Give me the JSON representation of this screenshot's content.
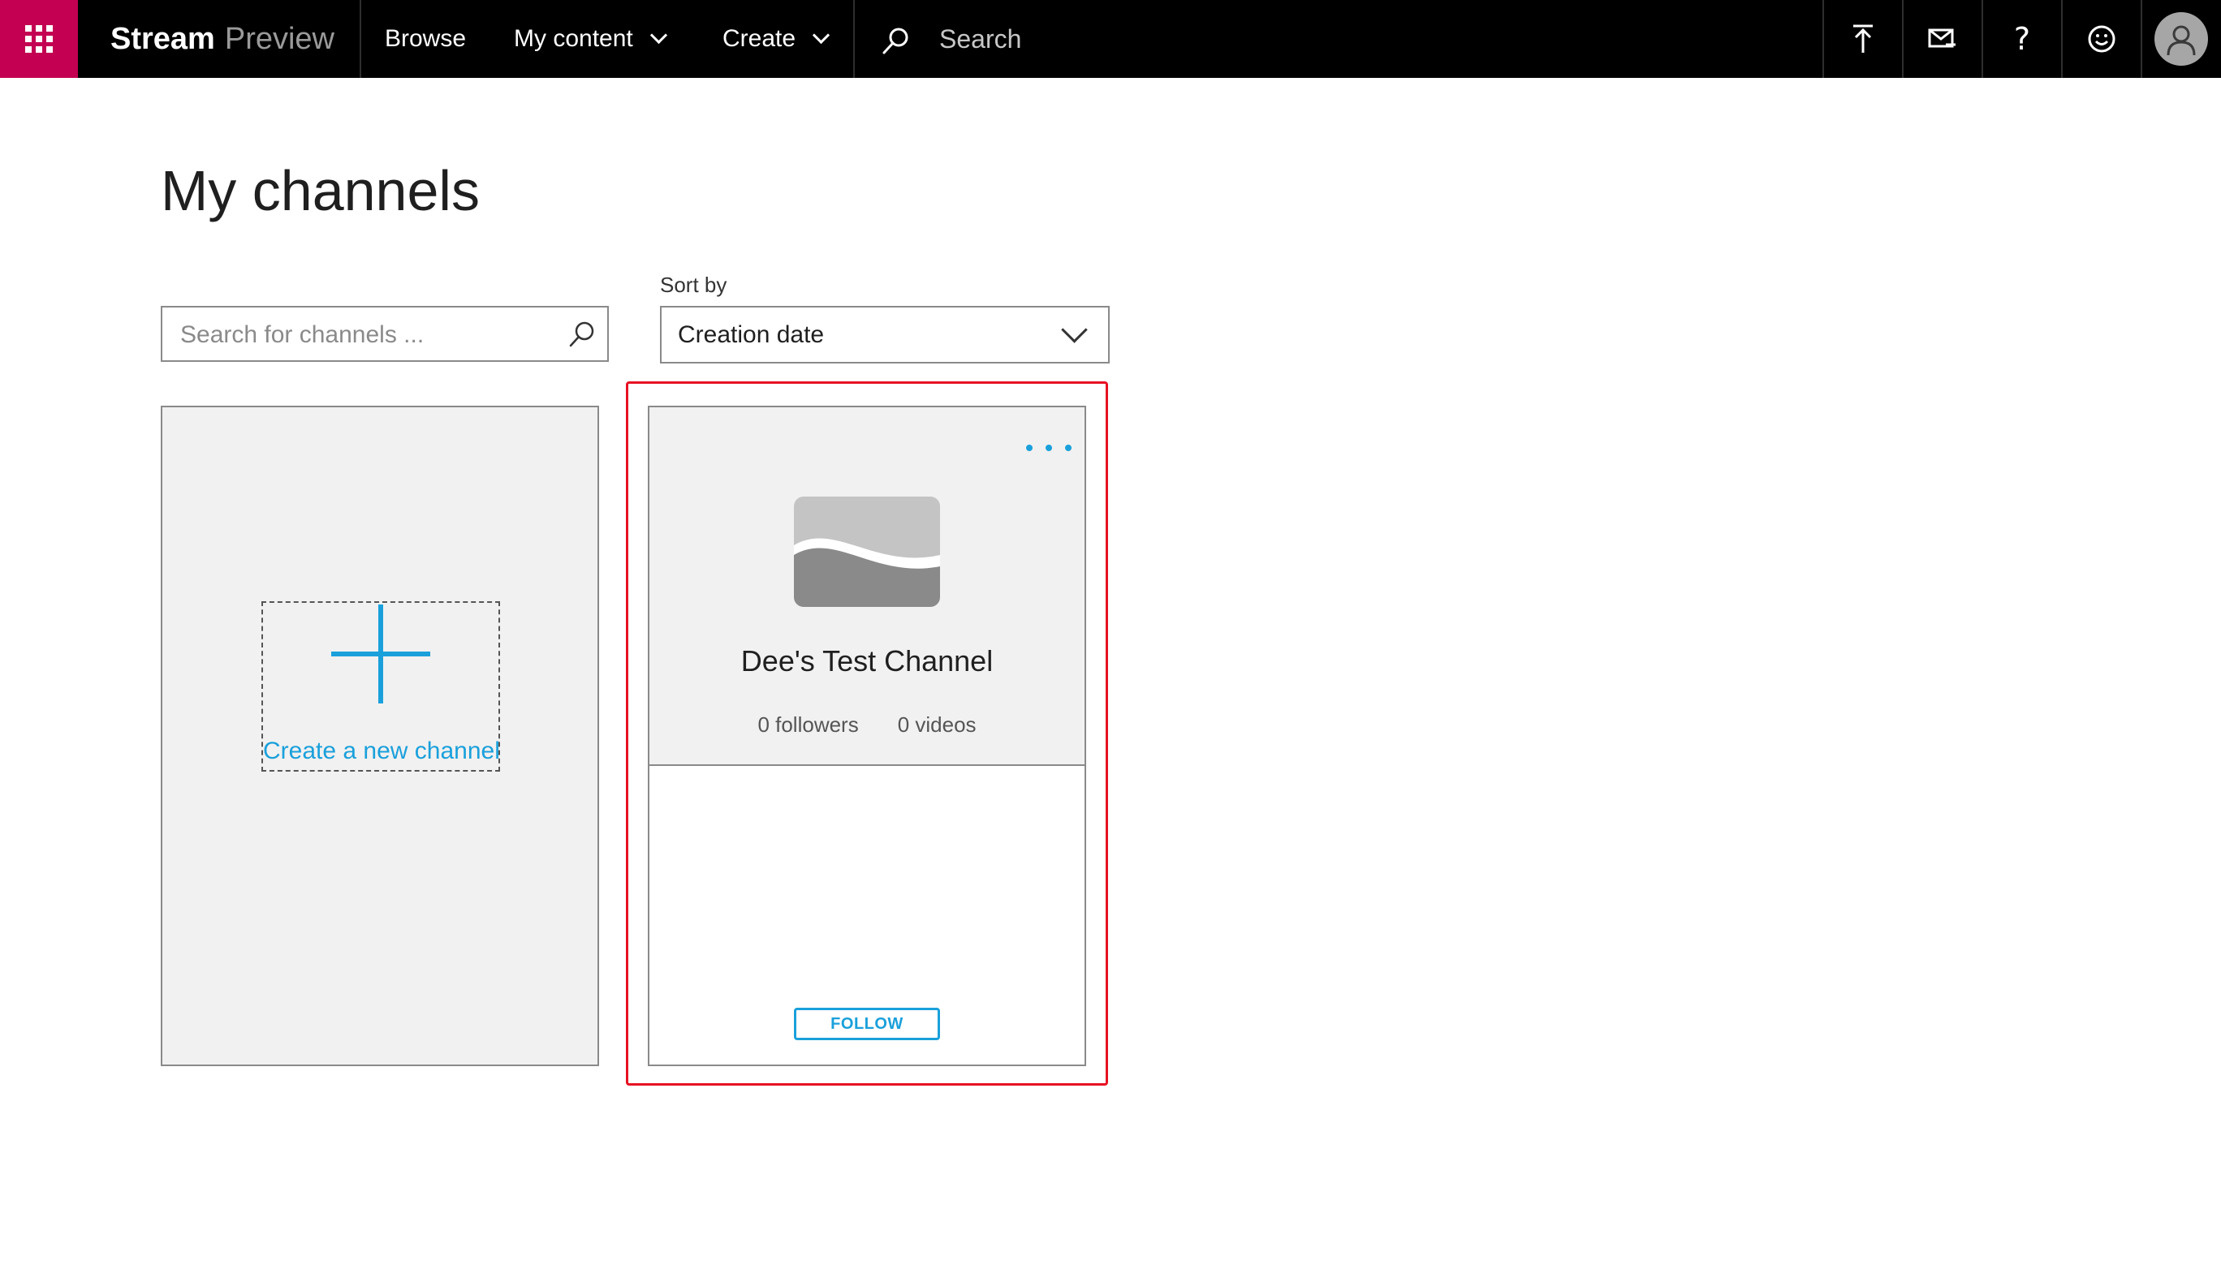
{
  "app": {
    "brand_bold": "Stream",
    "brand_light": "Preview"
  },
  "nav": {
    "browse": "Browse",
    "my_content": "My content",
    "create": "Create"
  },
  "top_search": {
    "placeholder": "Search"
  },
  "page": {
    "title": "My channels",
    "search": {
      "placeholder": "Search for channels ..."
    },
    "sort": {
      "label": "Sort by",
      "value": "Creation date"
    }
  },
  "create_card": {
    "label": "Create a new channel"
  },
  "channel": {
    "name": "Dee's Test Channel",
    "followers": "0 followers",
    "videos": "0 videos",
    "follow_label": "FOLLOW"
  },
  "colors": {
    "waffle_bg": "#c30052",
    "accent": "#1aa0db",
    "highlight": "#e81123",
    "topbar": "#000000"
  },
  "icons": [
    "app-launcher-icon",
    "search-icon",
    "upload-icon",
    "mail-icon",
    "help-icon",
    "smiley-icon",
    "user-icon",
    "chevron-down-icon",
    "plus-icon",
    "more-icon",
    "channel-image-icon"
  ]
}
